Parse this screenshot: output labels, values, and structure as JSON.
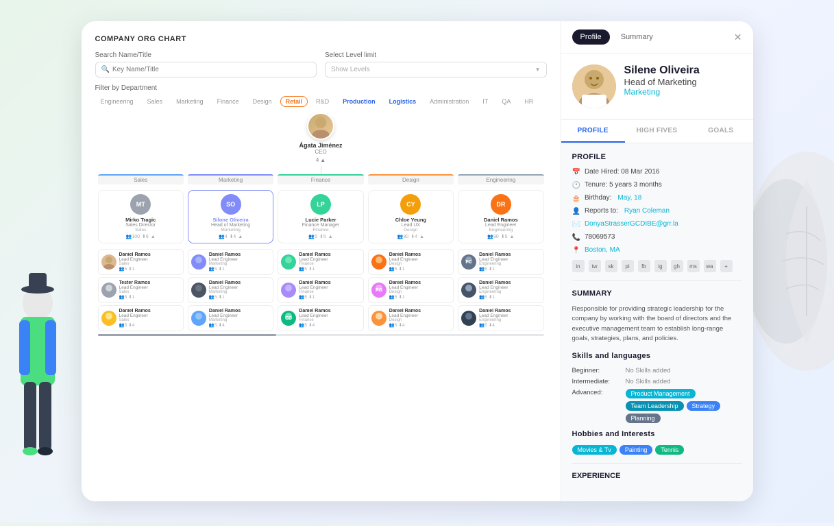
{
  "app": {
    "title": "COMPANY ORG CHART"
  },
  "search": {
    "label": "Search Name/Title",
    "placeholder": "Key Name/Title"
  },
  "level": {
    "label": "Select Level limit",
    "placeholder": "Show Levels"
  },
  "filter": {
    "label": "Filter by Department"
  },
  "departments": [
    {
      "name": "Engineering",
      "state": "normal"
    },
    {
      "name": "Sales",
      "state": "normal"
    },
    {
      "name": "Marketing",
      "state": "normal"
    },
    {
      "name": "Finance",
      "state": "normal"
    },
    {
      "name": "Design",
      "state": "normal"
    },
    {
      "name": "Retail",
      "state": "active-orange"
    },
    {
      "name": "R&D",
      "state": "normal"
    },
    {
      "name": "Production",
      "state": "active-blue"
    },
    {
      "name": "Logistics",
      "state": "active-blue"
    },
    {
      "name": "Administration",
      "state": "normal"
    },
    {
      "name": "IT",
      "state": "normal"
    },
    {
      "name": "QA",
      "state": "normal"
    },
    {
      "name": "HR",
      "state": "normal"
    }
  ],
  "ceo": {
    "name": "Ágata Jiménez",
    "title": "CEO",
    "expand": "4"
  },
  "columns": [
    {
      "label": "Sales",
      "type": "sales"
    },
    {
      "label": "Marketing",
      "type": "marketing"
    },
    {
      "label": "Finance",
      "type": "finance"
    },
    {
      "label": "Design",
      "type": "design"
    },
    {
      "label": "Engineering",
      "type": "engineering"
    }
  ],
  "directors": [
    {
      "initials": "MT",
      "name": "Mirko Tragic",
      "role": "Sales Director",
      "dept": "Sales",
      "color": "#9ca3af",
      "count": "100",
      "sub": "6"
    },
    {
      "initials": "SO",
      "name": "Silone Oliveira",
      "role": "Head of Marketing",
      "dept": "Marketing",
      "color": "#818cf8",
      "count": "4",
      "sub": "4",
      "highlighted": true,
      "link": true
    },
    {
      "initials": "LP",
      "name": "Lucie Parker",
      "role": "Finance Manager",
      "dept": "Finance",
      "color": "#34d399",
      "count": "5",
      "sub": "5"
    },
    {
      "initials": "CY",
      "name": "Chloe Yeung",
      "role": "Lead UX",
      "dept": "Design",
      "color": "#fb923c",
      "count": "80",
      "sub": "4"
    },
    {
      "initials": "DR",
      "name": "Daniel Ramos",
      "role": "Lead Engineer",
      "dept": "Engineering",
      "color": "#f97316",
      "count": "90",
      "sub": "5"
    }
  ],
  "sub_employees": [
    {
      "name": "Daniel Ramos",
      "role": "Lead Engineer",
      "dept": "Sales",
      "count": "5",
      "sub": "1"
    },
    {
      "name": "Daniel Ramos",
      "role": "Lead Engineer",
      "dept": "Marketing",
      "count": "5",
      "sub": "1"
    },
    {
      "name": "Daniel Ramos",
      "role": "Lead Engineer",
      "dept": "Finance",
      "count": "5",
      "sub": "1"
    },
    {
      "name": "Daniel Ramos",
      "role": "Lead Engineer",
      "dept": "Design",
      "count": "5",
      "sub": "1"
    },
    {
      "name": "Daniel Ramos",
      "role": "Lead Engineer",
      "dept": "Engineering",
      "count": "5",
      "sub": "1"
    }
  ],
  "profile": {
    "tabs": {
      "profile": "Profile",
      "summary": "Summary"
    },
    "close": "✕",
    "name": "Silene Oliveira",
    "title": "Head of Marketing",
    "department": "Marketing",
    "sub_tabs": [
      "PROFILE",
      "HIGH FIVES",
      "GOALS"
    ],
    "section_title": "PROFILE",
    "date_hired": "Date Hired: 08 Mar 2016",
    "tenure": "Tenure: 5 years 3 months",
    "birthday": "Birthday:",
    "birthday_date": "May, 18",
    "reports_to_label": "Reports to:",
    "reports_to": "Ryan Coleman",
    "email": "DonyaStrasserGCDIBE@grr.la",
    "phone": "78069573",
    "location": "Boston, MA",
    "social_icons": [
      "in",
      "tw",
      "sk",
      "pi",
      "fb",
      "ig",
      "gh",
      "ms",
      "wa",
      "+"
    ],
    "summary_title": "SUMMARY",
    "summary_text": "Responsible for providing strategic leadership for the company by working with the board of directors and the executive management team to establish long-range goals, strategies, plans, and policies.",
    "skills_title": "Skills and languages",
    "skills": [
      {
        "level": "Beginner:",
        "value": "No Skills added"
      },
      {
        "level": "Intermediate:",
        "value": "No Skills added"
      },
      {
        "level": "Advanced:",
        "tags": [
          "Product Management",
          "Team Leadership",
          "Strategy",
          "Planning"
        ]
      }
    ],
    "hobbies_title": "Hobbies and Interests",
    "hobbies": [
      "Movies & Tv",
      "Painting",
      "Tennis"
    ],
    "experience_title": "EXPERIENCE"
  }
}
